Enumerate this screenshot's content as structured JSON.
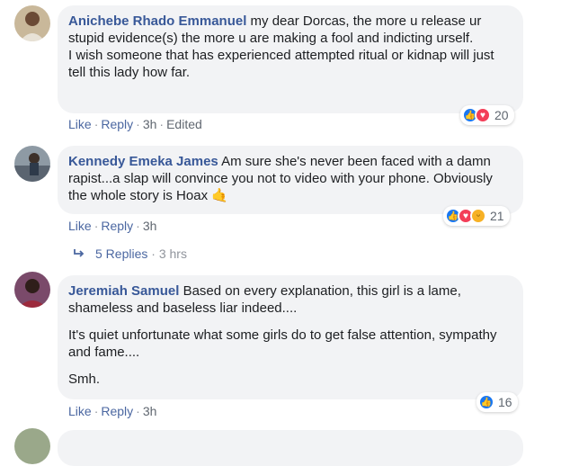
{
  "colors": {
    "link": "#385898",
    "bubble": "#f2f3f5",
    "like_blue": "#1877f2",
    "love_red": "#f33e58",
    "haha_yellow": "#f7b125"
  },
  "comments": [
    {
      "author": "Anichebe Rhado Emmanuel",
      "paragraphs": [
        "my dear Dorcas, the more u release ur stupid evidence(s) the more u are making a fool and indicting urself.",
        "I wish someone that has experienced attempted ritual or kidnap will just tell this lady how far."
      ],
      "actions": {
        "like": "Like",
        "reply": "Reply",
        "time": "3h",
        "edited": "Edited"
      },
      "reactions": {
        "icons": [
          "like-icon",
          "love-icon"
        ],
        "count": "20"
      }
    },
    {
      "author": "Kennedy Emeka James",
      "paragraphs": [
        "Am sure she's never been faced with a damn rapist...a slap will convince you not to video with your phone. Obviously the whole story is Hoax 🤙"
      ],
      "actions": {
        "like": "Like",
        "reply": "Reply",
        "time": "3h"
      },
      "reactions": {
        "icons": [
          "like-icon",
          "love-icon",
          "haha-icon"
        ],
        "count": "21"
      },
      "replies": {
        "label": "5 Replies",
        "time": "3 hrs"
      }
    },
    {
      "author": "Jeremiah Samuel",
      "paragraphs": [
        "Based on every explanation, this girl is a lame, shameless and baseless liar indeed....",
        "It's quiet unfortunate what some girls do to get false attention, sympathy and fame....",
        "Smh."
      ],
      "actions": {
        "like": "Like",
        "reply": "Reply",
        "time": "3h"
      },
      "reactions": {
        "icons": [
          "like-icon"
        ],
        "count": "16"
      }
    }
  ]
}
